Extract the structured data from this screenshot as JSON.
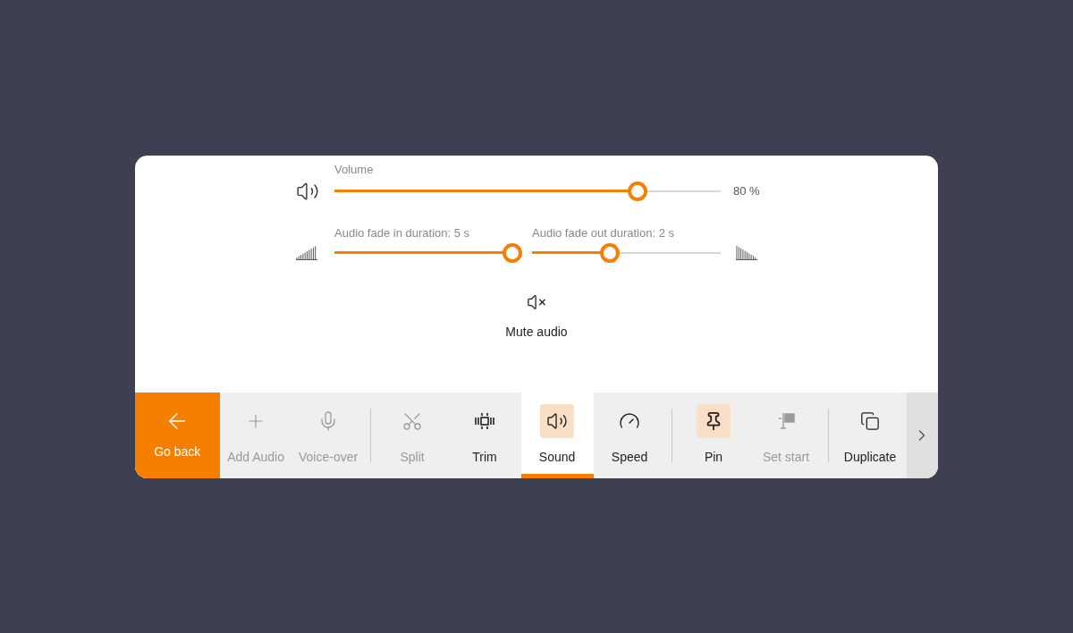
{
  "volume": {
    "label": "Volume",
    "level": 0.8,
    "reading": "80 %"
  },
  "fades": [
    {
      "label": "Audio fade in duration: 5 s",
      "level": 1.0
    },
    {
      "label": "Audio fade out duration: 2 s",
      "level": 0.4
    }
  ],
  "mute": {
    "label": "Mute audio"
  },
  "toolbar": {
    "back": {
      "label": "Go back"
    },
    "items": [
      {
        "kind": "tool",
        "label": "Add Audio",
        "disabled": true,
        "selected": false,
        "toggled": false
      },
      {
        "kind": "tool",
        "label": "Voice-over",
        "disabled": true,
        "selected": false,
        "toggled": false
      },
      {
        "kind": "separator"
      },
      {
        "kind": "tool",
        "label": "Split",
        "disabled": true,
        "selected": false,
        "toggled": false
      },
      {
        "kind": "tool",
        "label": "Trim",
        "disabled": false,
        "selected": false,
        "toggled": false
      },
      {
        "kind": "tool",
        "label": "Sound",
        "disabled": false,
        "selected": true,
        "toggled": true
      },
      {
        "kind": "tool",
        "label": "Speed",
        "disabled": false,
        "selected": false,
        "toggled": false
      },
      {
        "kind": "separator"
      },
      {
        "kind": "tool",
        "label": "Pin",
        "disabled": false,
        "selected": false,
        "toggled": true
      },
      {
        "kind": "tool",
        "label": "Set start",
        "disabled": true,
        "selected": false,
        "toggled": false
      },
      {
        "kind": "separator"
      },
      {
        "kind": "tool",
        "label": "Duplicate",
        "disabled": false,
        "selected": false,
        "toggled": false
      }
    ]
  }
}
